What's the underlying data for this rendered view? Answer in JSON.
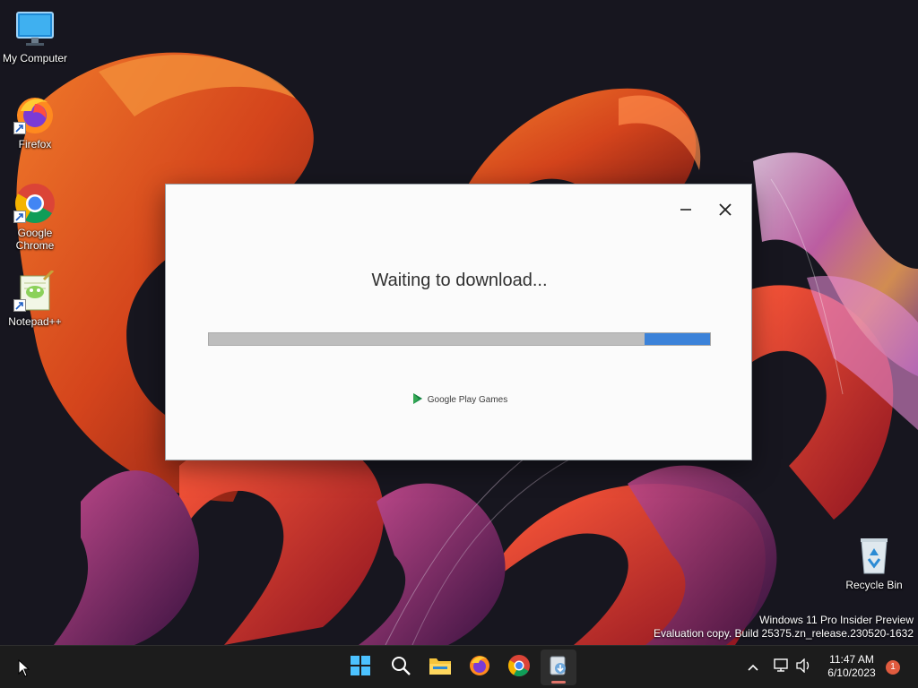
{
  "desktop": {
    "icons": [
      {
        "label": "My Computer",
        "icon": "monitor-icon"
      },
      {
        "label": "Firefox",
        "icon": "firefox-icon"
      },
      {
        "label": "Google\nChrome",
        "icon": "chrome-icon"
      },
      {
        "label": "Notepad++",
        "icon": "notepadpp-icon"
      },
      {
        "label": "Recycle Bin",
        "icon": "recycle-bin-icon"
      }
    ],
    "watermark": {
      "line1": "Windows 11 Pro Insider Preview",
      "line2": "Evaluation copy. Build 25375.zn_release.230520-1632"
    }
  },
  "dialog": {
    "title": "Waiting to download...",
    "progress": {
      "fill_start": 0.87,
      "fill_end": 1.0,
      "state": "indeterminate"
    },
    "brand": "Google Play Games",
    "minimize_icon": "minimize-icon",
    "close_icon": "close-icon"
  },
  "taskbar": {
    "apps": [
      "start-icon",
      "search-icon",
      "file-explorer-icon",
      "firefox-icon",
      "chrome-icon",
      "installer-icon"
    ],
    "active_app": "installer-icon",
    "clock": {
      "time": "11:47 AM",
      "date": "6/10/2023"
    },
    "notification_count": "1"
  },
  "colors": {
    "accent_blue": "#3b82d9",
    "dialog_bg": "#fbfbfb",
    "taskbar_bg": "#1c1c1c"
  }
}
